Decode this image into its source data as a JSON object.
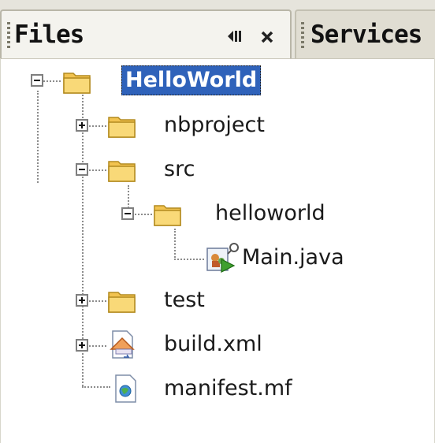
{
  "tabs": [
    {
      "label": "Files",
      "active": true
    },
    {
      "label": "Services",
      "active": false
    }
  ],
  "tab_buttons": {
    "minimize_icon": "minimize-window-icon",
    "close_icon": "close-icon"
  },
  "tree": {
    "root": {
      "label": "HelloWorld",
      "expanded": true,
      "selected": true,
      "icon": "project-folder-icon"
    },
    "items": [
      {
        "label": "nbproject",
        "icon": "folder-icon",
        "expanded": false
      },
      {
        "label": "src",
        "icon": "folder-icon",
        "expanded": true
      },
      {
        "label": "helloworld",
        "icon": "package-folder-icon",
        "expanded": true
      },
      {
        "label": "Main.java",
        "icon": "java-class-icon"
      },
      {
        "label": "test",
        "icon": "folder-icon",
        "expanded": false
      },
      {
        "label": "build.xml",
        "icon": "ant-build-file-icon",
        "expanded": false
      },
      {
        "label": "manifest.mf",
        "icon": "manifest-file-icon"
      }
    ]
  },
  "colors": {
    "selection": "#2f62ba",
    "folder": "#f2c350",
    "tab_bg": "#e6e4dc"
  }
}
